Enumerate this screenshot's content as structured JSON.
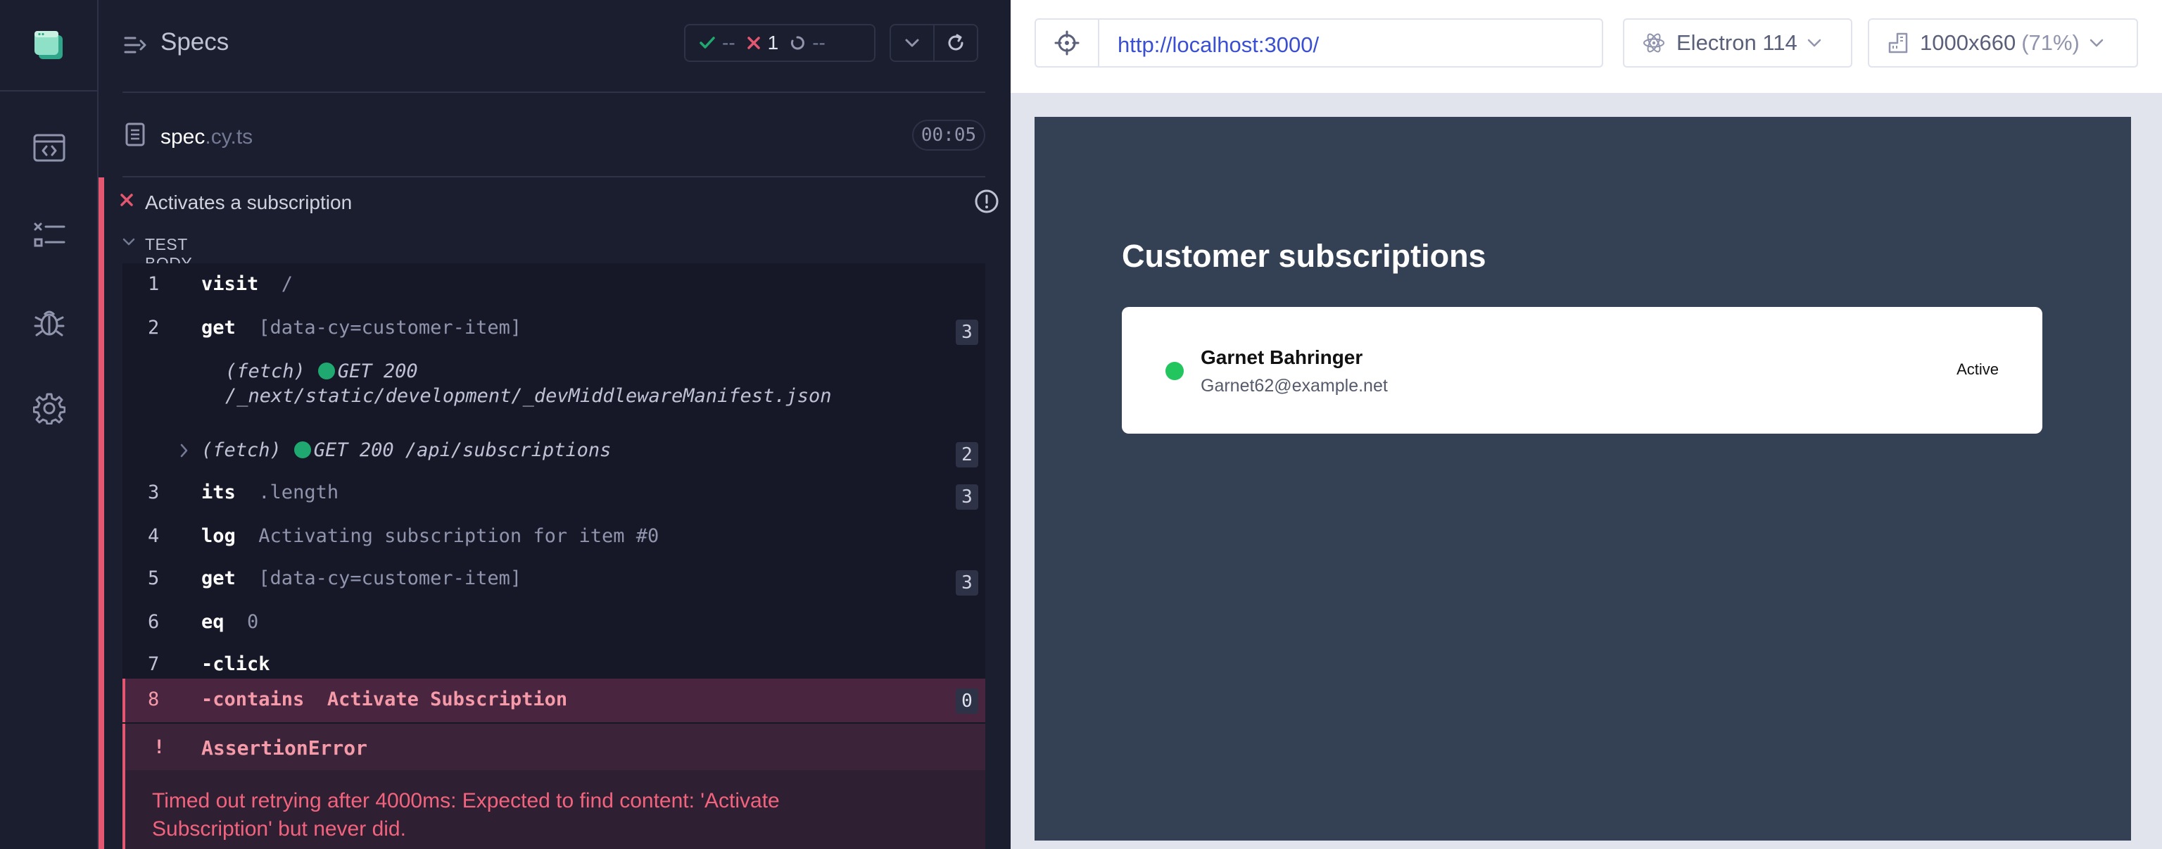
{
  "colors": {
    "fail": "#e45770",
    "pass": "#1fa971",
    "accent": "#3a4fd1",
    "active_dot": "#22c55e",
    "frame_bg": "#344154"
  },
  "sidebar": {
    "items": [
      {
        "name": "specs-icon"
      },
      {
        "name": "runs-icon"
      },
      {
        "name": "debug-icon"
      },
      {
        "name": "settings-icon"
      }
    ]
  },
  "reporter": {
    "title": "Specs",
    "stats": {
      "passed": "--",
      "failed": "1",
      "pending": "--"
    },
    "spec": {
      "base": "spec",
      "ext": ".cy.ts",
      "duration": "00:05"
    },
    "test": {
      "title": "Activates a subscription",
      "body_label": "TEST BODY",
      "commands": [
        {
          "num": "1",
          "name": "visit",
          "msg": "/",
          "badge": ""
        },
        {
          "num": "2",
          "name": "get",
          "msg": "[data-cy=customer-item]",
          "badge": "3"
        },
        {
          "num": "3",
          "name": "its",
          "msg": ".length",
          "badge": "3"
        },
        {
          "num": "4",
          "name": "log",
          "msg": "Activating subscription for item #0",
          "badge": ""
        },
        {
          "num": "5",
          "name": "get",
          "msg": "[data-cy=customer-item]",
          "badge": "3"
        },
        {
          "num": "6",
          "name": "eq",
          "msg": "0",
          "badge": ""
        },
        {
          "num": "7",
          "name": "-click",
          "msg": "",
          "badge": ""
        }
      ],
      "fetch_1": {
        "label": "(fetch)",
        "request": "GET 200",
        "path": "/_next/static/development/_devMiddlewareManifest.json"
      },
      "fetch_2": {
        "label": "(fetch)",
        "request": "GET 200 /api/subscriptions",
        "badge": "2"
      },
      "failed_command": {
        "num": "8",
        "name": "-contains",
        "msg": "Activate Subscription",
        "badge": "0"
      },
      "error": {
        "bang": "!",
        "type": "AssertionError",
        "message": "Timed out retrying after 4000ms: Expected to find content: 'Activate Subscription' but never did."
      }
    }
  },
  "aut": {
    "url": "http://localhost:3000/",
    "browser": "Electron 114",
    "viewport": "1000x660",
    "scale": "(71%)",
    "app": {
      "title": "Customer subscriptions",
      "customer": {
        "name": "Garnet Bahringer",
        "email": "Garnet62@example.net",
        "status": "Active"
      }
    }
  }
}
